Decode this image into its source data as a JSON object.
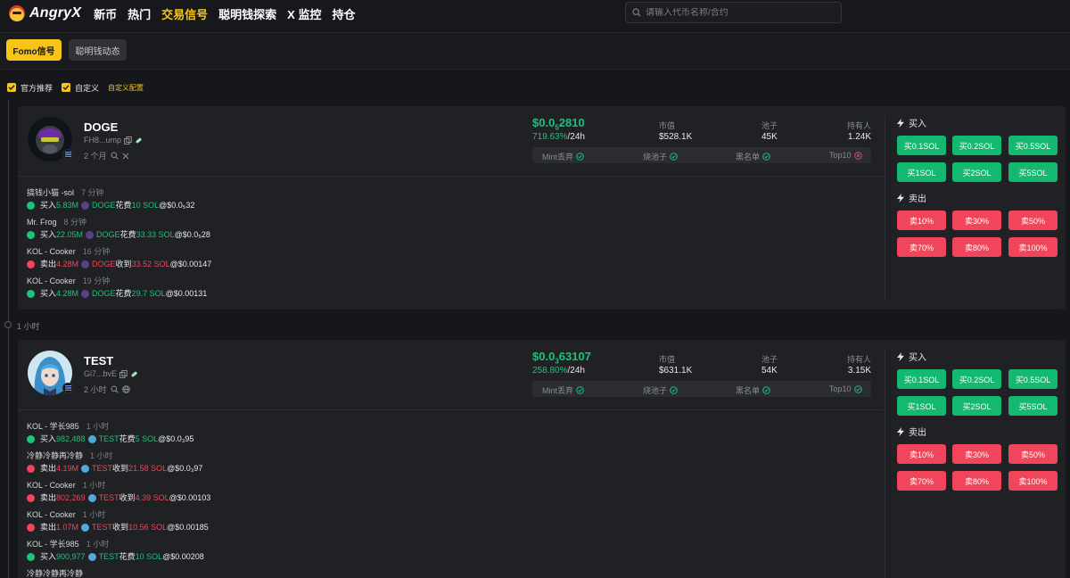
{
  "brand": {
    "name": "AngryX"
  },
  "nav": [
    {
      "label": "新币",
      "active": false
    },
    {
      "label": "热门",
      "active": false
    },
    {
      "label": "交易信号",
      "active": true
    },
    {
      "label": "聪明钱探索",
      "active": false
    },
    {
      "label": "X 监控",
      "active": false
    },
    {
      "label": "持仓",
      "active": false
    }
  ],
  "search": {
    "placeholder": "请输入代币名称/合约"
  },
  "tabs": [
    {
      "label": "Fomo信号",
      "active": true
    },
    {
      "label": "聪明钱动态",
      "active": false
    }
  ],
  "filters": {
    "official": "官方推荐",
    "custom": "自定义",
    "config_link": "自定义配置"
  },
  "time_separator": "1 小时",
  "labels": {
    "market_cap": "市值",
    "pool": "池子",
    "holders": "持有人",
    "per_24h": "/24h",
    "buy_title": "买入",
    "sell_title": "卖出",
    "check_mint": "Mint丢弃",
    "check_burn": "烧池子",
    "check_blacklist": "黑名单",
    "check_top10": "Top10"
  },
  "colors": {
    "accent": "#f5c518",
    "up": "#1ec27a",
    "down": "#f0455a"
  },
  "cards": [
    {
      "symbol": "DOGE",
      "address": "FH8...ump",
      "age": "2 个月",
      "price_prefix": "$0.0",
      "price_sub": "5",
      "price_rest": "2810",
      "change": "719.63%",
      "market_cap": "$528.1K",
      "pool": "45K",
      "holders": "1.24K",
      "checks": {
        "mint": true,
        "burn": true,
        "blacklist": true,
        "top10": false
      },
      "buy_buttons": [
        "买0.1SOL",
        "买0.2SOL",
        "买0.5SOL",
        "买1SOL",
        "买2SOL",
        "买5SOL"
      ],
      "sell_buttons": [
        "卖10%",
        "卖30%",
        "卖50%",
        "卖70%",
        "卖80%",
        "卖100%"
      ],
      "trades": [
        {
          "trader": "搞钱小猫 -sol",
          "ago": "7 分钟",
          "side": "buy",
          "action": "买入",
          "amount": "5.83M",
          "token": "DOGE",
          "verb": "花费",
          "sol": "10 SOL",
          "price": "@$0.0₅32"
        },
        {
          "trader": "Mr. Frog",
          "ago": "8 分钟",
          "side": "buy",
          "action": "买入",
          "amount": "22.05M",
          "token": "DOGE",
          "verb": "花费",
          "sol": "33.33 SOL",
          "price": "@$0.0₅28"
        },
        {
          "trader": "KOL - Cooker",
          "ago": "16 分钟",
          "side": "sell",
          "action": "卖出",
          "amount": "4.28M",
          "token": "DOGE",
          "verb": "收到",
          "sol": "33.52 SOL",
          "price": "@$0.00147"
        },
        {
          "trader": "KOL - Cooker",
          "ago": "19 分钟",
          "side": "buy",
          "action": "买入",
          "amount": "4.28M",
          "token": "DOGE",
          "verb": "花费",
          "sol": "29.7 SOL",
          "price": "@$0.00131"
        }
      ]
    },
    {
      "symbol": "TEST",
      "address": "Gi7...bvE",
      "age": "2 小时",
      "price_prefix": "$0.0",
      "price_sub": "3",
      "price_rest": "63107",
      "change": "258.80%",
      "market_cap": "$631.1K",
      "pool": "54K",
      "holders": "3.15K",
      "checks": {
        "mint": true,
        "burn": true,
        "blacklist": true,
        "top10": true
      },
      "buy_buttons": [
        "买0.1SOL",
        "买0.2SOL",
        "买0.5SOL",
        "买1SOL",
        "买2SOL",
        "买5SOL"
      ],
      "sell_buttons": [
        "卖10%",
        "卖30%",
        "卖50%",
        "卖70%",
        "卖80%",
        "卖100%"
      ],
      "trades": [
        {
          "trader": "KOL - 学长985",
          "ago": "1 小时",
          "side": "buy",
          "action": "买入",
          "amount": "982,488",
          "token": "TEST",
          "verb": "花费",
          "sol": "5 SOL",
          "price": "@$0.0₃95"
        },
        {
          "trader": "冷静冷静再冷静",
          "ago": "1 小时",
          "side": "sell",
          "action": "卖出",
          "amount": "4.19M",
          "token": "TEST",
          "verb": "收到",
          "sol": "21.58 SOL",
          "price": "@$0.0₃97"
        },
        {
          "trader": "KOL - Cooker",
          "ago": "1 小时",
          "side": "sell",
          "action": "卖出",
          "amount": "802,269",
          "token": "TEST",
          "verb": "收到",
          "sol": "4.39 SOL",
          "price": "@$0.00103"
        },
        {
          "trader": "KOL - Cooker",
          "ago": "1 小时",
          "side": "sell",
          "action": "卖出",
          "amount": "1.07M",
          "token": "TEST",
          "verb": "收到",
          "sol": "10.56 SOL",
          "price": "@$0.00185"
        },
        {
          "trader": "KOL - 学长985",
          "ago": "1 小时",
          "side": "buy",
          "action": "买入",
          "amount": "900,977",
          "token": "TEST",
          "verb": "花费",
          "sol": "10 SOL",
          "price": "@$0.00208"
        },
        {
          "trader": "冷静冷静再冷静",
          "ago": "",
          "side": "",
          "action": "",
          "amount": "",
          "token": "",
          "verb": "",
          "sol": "",
          "price": ""
        }
      ]
    }
  ]
}
